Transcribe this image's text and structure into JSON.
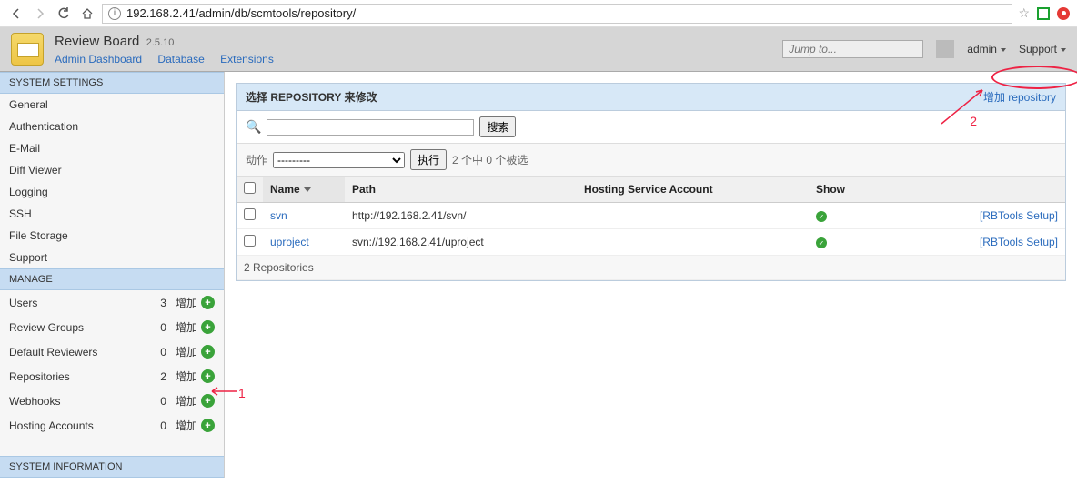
{
  "browser": {
    "url": "192.168.2.41/admin/db/scmtools/repository/"
  },
  "app": {
    "name": "Review Board",
    "version": "2.5.10",
    "links": {
      "dashboard": "Admin Dashboard",
      "database": "Database",
      "extensions": "Extensions"
    },
    "jump_placeholder": "Jump to...",
    "user": "admin",
    "support": "Support"
  },
  "sidebar": {
    "sections": {
      "settings_title": "SYSTEM SETTINGS",
      "settings": [
        "General",
        "Authentication",
        "E-Mail",
        "Diff Viewer",
        "Logging",
        "SSH",
        "File Storage",
        "Support"
      ],
      "manage_title": "MANAGE",
      "manage": [
        {
          "label": "Users",
          "count": 3,
          "add": "增加"
        },
        {
          "label": "Review Groups",
          "count": 0,
          "add": "增加"
        },
        {
          "label": "Default Reviewers",
          "count": 0,
          "add": "增加"
        },
        {
          "label": "Repositories",
          "count": 2,
          "add": "增加"
        },
        {
          "label": "Webhooks",
          "count": 0,
          "add": "增加"
        },
        {
          "label": "Hosting Accounts",
          "count": 0,
          "add": "增加"
        }
      ],
      "sysinfo_title": "SYSTEM INFORMATION"
    }
  },
  "panel": {
    "title": "选择 REPOSITORY 来修改",
    "add_label": "增加 repository",
    "search_button": "搜索",
    "action_label": "动作",
    "action_placeholder": "---------",
    "go_button": "执行",
    "selection_text": "2 个中 0 个被选",
    "columns": {
      "name": "Name",
      "path": "Path",
      "hosting": "Hosting Service Account",
      "show": "Show"
    },
    "rows": [
      {
        "name": "svn",
        "path": "http://192.168.2.41/svn/",
        "hosting": "",
        "show": true,
        "tools": "[RBTools Setup]"
      },
      {
        "name": "uproject",
        "path": "svn://192.168.2.41/uproject",
        "hosting": "",
        "show": true,
        "tools": "[RBTools Setup]"
      }
    ],
    "footer": "2 Repositories"
  },
  "annotations": {
    "one": "1",
    "two": "2"
  }
}
